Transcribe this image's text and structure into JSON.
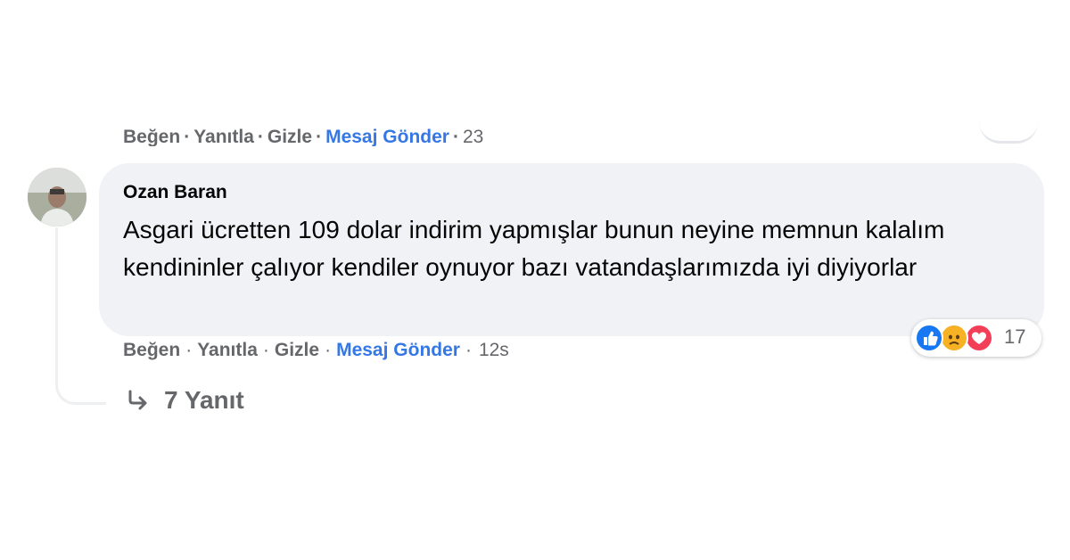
{
  "previous_comment": {
    "actions": {
      "like": "Beğen",
      "reply": "Yanıtla",
      "hide": "Gizle",
      "message": "Mesaj Gönder",
      "time": "23"
    }
  },
  "comment": {
    "author": "Ozan Baran",
    "avatar_icon": "user-avatar-photo",
    "text": "Asgari ücretten 109 dolar indirim yapmışlar bunun neyine memnun kalalım kendininler çalıyor kendiler oynuyor bazı vatandaşlarımızda iyi diyiyorlar",
    "reactions": {
      "icons": [
        "like-icon",
        "sad-icon",
        "love-icon"
      ],
      "count": "17"
    },
    "actions": {
      "like": "Beğen",
      "reply": "Yanıtla",
      "hide": "Gizle",
      "message": "Mesaj Gönder",
      "time": "12s",
      "separator": "·"
    }
  },
  "replies": {
    "label": "7 Yanıt",
    "icon": "reply-arrow-icon"
  },
  "colors": {
    "bubble": "#f0f2f5",
    "action_text": "#65676b",
    "link_blue": "#3578e5",
    "like_blue": "#1877f2",
    "sad_yellow": "#f7b125",
    "love_red": "#f33e58"
  }
}
